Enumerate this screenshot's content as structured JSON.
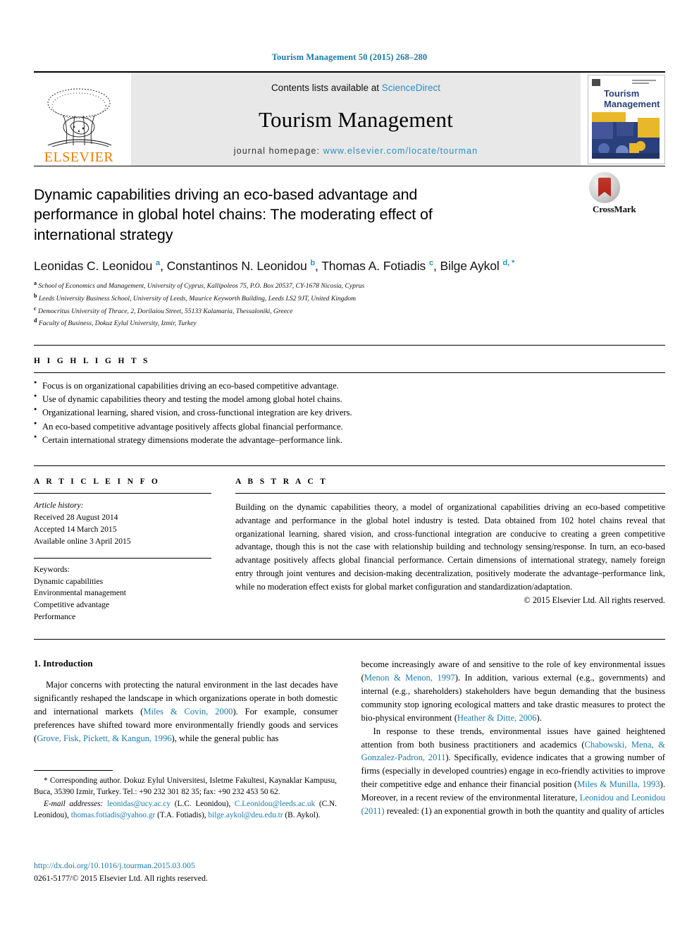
{
  "running_head": "Tourism Management 50 (2015) 268–280",
  "masthead": {
    "publisher_name": "ELSEVIER",
    "contents_prefix": "Contents lists available at ",
    "contents_link": "ScienceDirect",
    "journal_title": "Tourism Management",
    "homepage_prefix": "journal homepage: ",
    "homepage_url": "www.elsevier.com/locate/tourman",
    "cover_title_line1": "Tourism",
    "cover_title_line2": "Management",
    "accent_link_color": "#2b8fc4",
    "elsevier_orange": "#ef7d00"
  },
  "article": {
    "title": "Dynamic capabilities driving an eco-based advantage and performance in global hotel chains: The moderating effect of international strategy",
    "crossmark_label": "CrossMark",
    "authors": [
      {
        "name": "Leonidas C. Leonidou",
        "mark": "a",
        "sep": ", "
      },
      {
        "name": "Constantinos N. Leonidou",
        "mark": "b",
        "sep": ", "
      },
      {
        "name": "Thomas A. Fotiadis",
        "mark": "c",
        "sep": ", "
      },
      {
        "name": "Bilge Aykol",
        "mark": "d, *",
        "sep": ""
      }
    ],
    "affiliations": [
      {
        "mark": "a",
        "text": "School of Economics and Management, University of Cyprus, Kallipoleos 75, P.O. Box 20537, CY-1678 Nicosia, Cyprus"
      },
      {
        "mark": "b",
        "text": "Leeds University Business School, University of Leeds, Maurice Keyworth Building, Leeds LS2 9JT, United Kingdom"
      },
      {
        "mark": "c",
        "text": "Democritus University of Thrace, 2, Dorilaiou Street, 55133 Kalamaria, Thessaloniki, Greece"
      },
      {
        "mark": "d",
        "text": "Faculty of Business, Dokuz Eylul University, Izmir, Turkey"
      }
    ]
  },
  "highlights": {
    "label": "H I G H L I G H T S",
    "items": [
      "Focus is on organizational capabilities driving an eco-based competitive advantage.",
      "Use of dynamic capabilities theory and testing the model among global hotel chains.",
      "Organizational learning, shared vision, and cross-functional integration are key drivers.",
      "An eco-based competitive advantage positively affects global financial performance.",
      "Certain international strategy dimensions moderate the advantage–performance link."
    ]
  },
  "article_info": {
    "label": "A R T I C L E   I N F O",
    "history_label": "Article history:",
    "history": [
      "Received 28 August 2014",
      "Accepted 14 March 2015",
      "Available online 3 April 2015"
    ],
    "keywords_label": "Keywords:",
    "keywords": [
      "Dynamic capabilities",
      "Environmental management",
      "Competitive advantage",
      "Performance"
    ]
  },
  "abstract": {
    "label": "A B S T R A C T",
    "text": "Building on the dynamic capabilities theory, a model of organizational capabilities driving an eco-based competitive advantage and performance in the global hotel industry is tested. Data obtained from 102 hotel chains reveal that organizational learning, shared vision, and cross-functional integration are conducive to creating a green competitive advantage, though this is not the case with relationship building and technology sensing/response. In turn, an eco-based advantage positively affects global financial performance. Certain dimensions of international strategy, namely foreign entry through joint ventures and decision-making decentralization, positively moderate the advantage–performance link, while no moderation effect exists for global market configuration and standardization/adaptation.",
    "copyright": "© 2015 Elsevier Ltd. All rights reserved."
  },
  "introduction": {
    "heading": "1. Introduction",
    "left_paragraph_parts": [
      {
        "t": "Major concerns with protecting the natural environment in the last decades have significantly reshaped the landscape in which organizations operate in both domestic and international markets (",
        "ref": false
      },
      {
        "t": "Miles & Covin, 2000",
        "ref": true
      },
      {
        "t": "). For example, consumer preferences have shifted toward more environmentally friendly goods and services (",
        "ref": false
      },
      {
        "t": "Grove, Fisk, Pickett, & Kangun, 1996",
        "ref": true
      },
      {
        "t": "), while the general public has",
        "ref": false
      }
    ],
    "right_paragraph1_parts": [
      {
        "t": "become increasingly aware of and sensitive to the role of key environmental issues (",
        "ref": false
      },
      {
        "t": "Menon & Menon, 1997",
        "ref": true
      },
      {
        "t": "). In addition, various external (e.g., governments) and internal (e.g., shareholders) stakeholders have begun demanding that the business community stop ignoring ecological matters and take drastic measures to protect the bio-physical environment (",
        "ref": false
      },
      {
        "t": "Heather & Ditte, 2006",
        "ref": true
      },
      {
        "t": ").",
        "ref": false
      }
    ],
    "right_paragraph2_parts": [
      {
        "t": "In response to these trends, environmental issues have gained heightened attention from both business practitioners and academics (",
        "ref": false
      },
      {
        "t": "Chabowski, Mena, & Gonzalez-Padron, 2011",
        "ref": true
      },
      {
        "t": "). Specifically, evidence indicates that a growing number of firms (especially in developed countries) engage in eco-friendly activities to improve their competitive edge and enhance their financial position (",
        "ref": false
      },
      {
        "t": "Miles & Munilla, 1993",
        "ref": true
      },
      {
        "t": "). Moreover, in a recent review of the environmental literature, ",
        "ref": false
      },
      {
        "t": "Leonidou and Leonidou (2011)",
        "ref": true
      },
      {
        "t": " revealed: (1) an exponential growth in both the quantity and quality of articles",
        "ref": false
      }
    ]
  },
  "footnote": {
    "corresponding_marker": "*",
    "corresponding_text": "Corresponding author. Dokuz Eylul Universitesi, Isletme Fakultesi, Kaynaklar Kampusu, Buca, 35390 Izmir, Turkey. Tel.: +90 232 301 82 35; fax: +90 232 453 50 62.",
    "email_label": "E-mail addresses:",
    "emails": [
      {
        "address": "leonidas@ucy.ac.cy",
        "owner": " (L.C. Leonidou), "
      },
      {
        "address": "C.Leonidou@leeds.ac.uk",
        "owner": " (C.N. Leonidou), "
      },
      {
        "address": "thomas.fotiadis@yahoo.gr",
        "owner": " (T.A. Fotiadis), "
      },
      {
        "address": "bilge.aykol@deu.edu.tr",
        "owner": " (B. Aykol)."
      }
    ]
  },
  "doi_block": {
    "doi_url": "http://dx.doi.org/10.1016/j.tourman.2015.03.005",
    "issn_line": "0261-5177/© 2015 Elsevier Ltd. All rights reserved."
  }
}
